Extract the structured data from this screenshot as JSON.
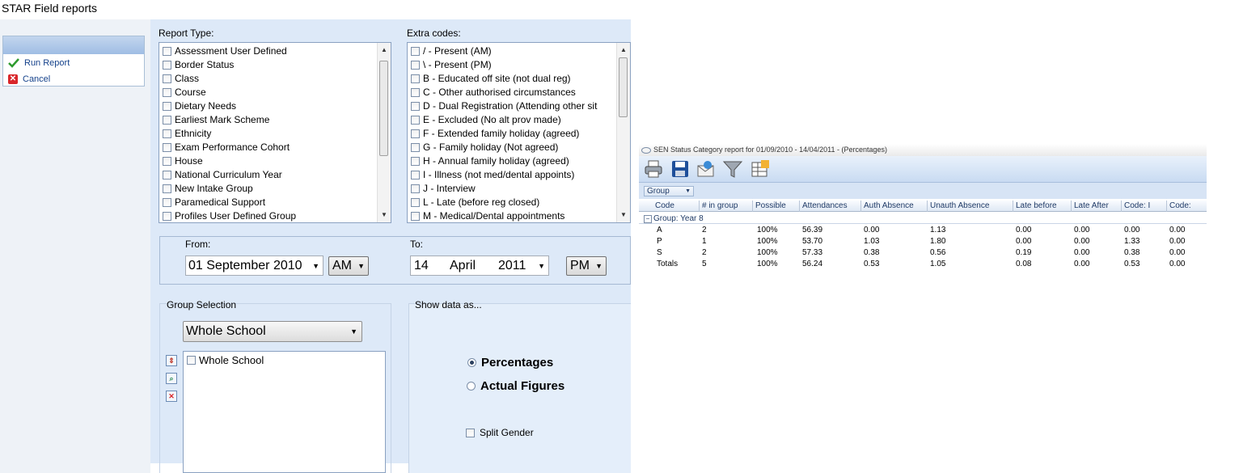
{
  "window": {
    "title": "STAR Field reports"
  },
  "actions": {
    "run_label": "Run Report",
    "cancel_label": "Cancel"
  },
  "report_type": {
    "label": "Report Type:",
    "items": [
      "Assessment User Defined",
      "Border Status",
      "Class",
      "Course",
      "Dietary Needs",
      "Earliest Mark Scheme",
      "Ethnicity",
      "Exam Performance Cohort",
      "House",
      "National Curriculum Year",
      "New Intake Group",
      "Paramedical Support",
      "Profiles User Defined Group"
    ]
  },
  "extra_codes": {
    "label": "Extra codes:",
    "items": [
      "/ - Present (AM)",
      "\\ - Present (PM)",
      "B - Educated off site (not dual reg)",
      "C - Other authorised circumstances",
      "D - Dual Registration (Attending other sit",
      "E - Excluded (No alt prov made)",
      "F - Extended family holiday (agreed)",
      "G - Family holiday (Not agreed)",
      "H - Annual family holiday (agreed)",
      "I - Illness (not med/dental appoints)",
      "J - Interview",
      "L - Late (before reg closed)",
      "M - Medical/Dental appointments"
    ]
  },
  "date": {
    "from_label": "From:",
    "from_value": "01 September 2010",
    "from_ampm": "AM",
    "to_label": "To:",
    "to_day": "14",
    "to_month": "April",
    "to_year": "2011",
    "to_ampm": "PM"
  },
  "group_selection": {
    "label": "Group Selection",
    "selected": "Whole School",
    "items": [
      "Whole School"
    ]
  },
  "show_data": {
    "label": "Show data as...",
    "options": [
      "Percentages",
      "Actual Figures"
    ],
    "selected": "Percentages",
    "split_gender_label": "Split Gender"
  },
  "report": {
    "title": "SEN Status Category report for 01/09/2010 - 14/04/2011 - (Percentages)",
    "group_chip": "Group",
    "columns": [
      "Code",
      "# in group",
      "Possible",
      "Attendances",
      "Auth Absence",
      "Unauth Absence",
      "Late before",
      "Late After",
      "Code: I",
      "Code:"
    ],
    "group_row": "Group: Year 8",
    "rows": [
      [
        "A",
        "2",
        "100%",
        "56.39",
        "0.00",
        "1.13",
        "0.00",
        "0.00",
        "0.00",
        "0.00"
      ],
      [
        "P",
        "1",
        "100%",
        "53.70",
        "1.03",
        "1.80",
        "0.00",
        "0.00",
        "1.33",
        "0.00"
      ],
      [
        "S",
        "2",
        "100%",
        "57.33",
        "0.38",
        "0.56",
        "0.19",
        "0.00",
        "0.38",
        "0.00"
      ],
      [
        "Totals",
        "5",
        "100%",
        "56.24",
        "0.53",
        "1.05",
        "0.08",
        "0.00",
        "0.53",
        "0.00"
      ]
    ]
  }
}
